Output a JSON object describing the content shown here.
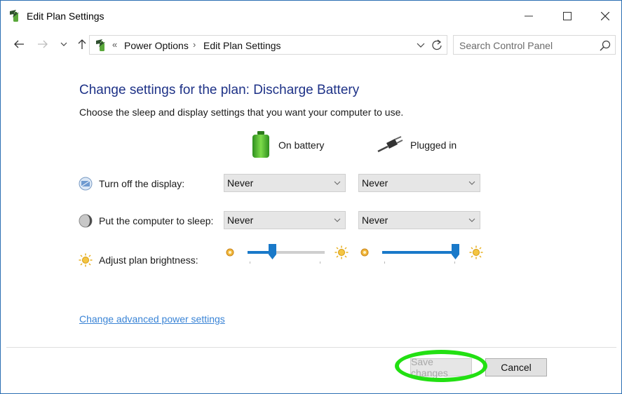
{
  "window": {
    "title": "Edit Plan Settings",
    "controls": [
      "minimize",
      "maximize",
      "close"
    ]
  },
  "address": {
    "overflow": "«",
    "crumbs": [
      "Power Options",
      "Edit Plan Settings"
    ],
    "separator": "›"
  },
  "search": {
    "placeholder": "Search Control Panel"
  },
  "content": {
    "heading": "Change settings for the plan: Discharge Battery",
    "subtext": "Choose the sleep and display settings that you want your computer to use."
  },
  "columns": {
    "battery": "On battery",
    "plugged": "Plugged in"
  },
  "settings": {
    "display": {
      "label": "Turn off the display:",
      "battery": "Never",
      "plugged": "Never"
    },
    "sleep": {
      "label": "Put the computer to sleep:",
      "battery": "Never",
      "plugged": "Never"
    },
    "brightness": {
      "label": "Adjust plan brightness:",
      "battery_level": 0.3,
      "plugged_level": 1.0
    }
  },
  "links": {
    "advanced": "Change advanced power settings"
  },
  "buttons": {
    "save": "Save changes",
    "cancel": "Cancel"
  },
  "colors": {
    "heading": "#1e3287",
    "link": "#3a84d6",
    "slider_thumb": "#1979c9",
    "highlight": "#22e012"
  },
  "icons": {
    "app": "power-plan-icon",
    "display": "display-icon",
    "sleep": "moon-icon",
    "brightness": "sun-icon",
    "battery": "battery-icon",
    "plug": "plug-icon"
  }
}
